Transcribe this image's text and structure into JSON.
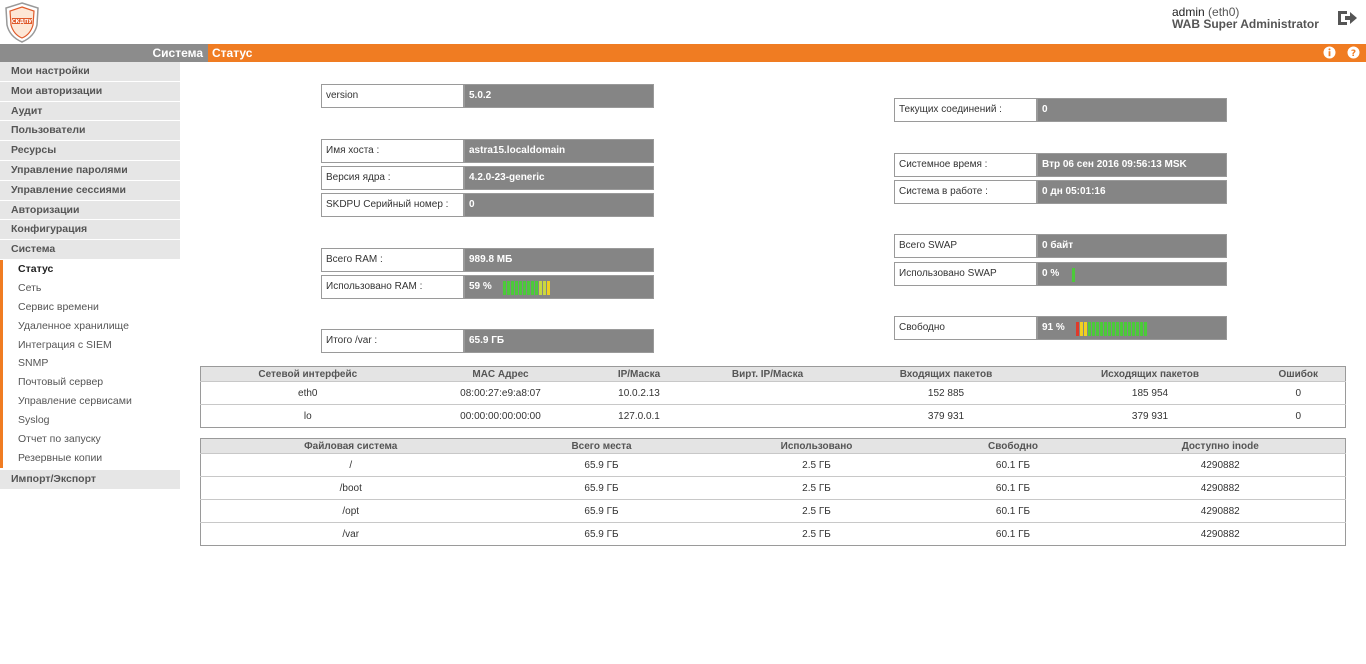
{
  "header": {
    "user": "admin",
    "interface": "(eth0)",
    "role": "WAB Super Administrator"
  },
  "bar": {
    "section": "Система",
    "page": "Статус"
  },
  "sidebar": {
    "top_items": [
      "Мои настройки",
      "Мои авторизации",
      "Аудит",
      "Пользователи",
      "Ресурсы",
      "Управление паролями",
      "Управление сессиями",
      "Авторизации",
      "Конфигурация",
      "Система"
    ],
    "sub_items": [
      "Статус",
      "Сеть",
      "Сервис времени",
      "Удаленное хранилище",
      "Интеграция с SIEM",
      "SNMP",
      "Почтовый сервер",
      "Управление сервисами",
      "Syslog",
      "Отчет по запуску",
      "Резервные копии"
    ],
    "bottom_item": "Импорт/Экспорт"
  },
  "left_info": {
    "version": {
      "label": "version",
      "value": "5.0.2"
    },
    "hostname": {
      "label": "Имя хоста :",
      "value": "astra15.localdomain"
    },
    "kernel": {
      "label": "Версия ядра :",
      "value": "4.2.0-23-generic"
    },
    "serial": {
      "label": "SKDPU Серийный номер :",
      "value": "0"
    },
    "ram_total": {
      "label": "Всего RAM :",
      "value": "989.8 МБ"
    },
    "ram_used": {
      "label": "Использовано RAM :",
      "value": "59 %",
      "fraction": 0.59
    },
    "var_total": {
      "label": "Итого /var :",
      "value": "65.9 ГБ"
    }
  },
  "right_info": {
    "connections": {
      "label": "Текущих соединений :",
      "value": "0"
    },
    "system_time": {
      "label": "Системное время :",
      "value": "Втр 06 сен 2016 09:56:13 MSK"
    },
    "uptime": {
      "label": "Система в работе :",
      "value": "0 дн 05:01:16"
    },
    "swap_total": {
      "label": "Всего SWAP",
      "value": "0 байт"
    },
    "swap_used": {
      "label": "Использовано SWAP",
      "value": "0 %",
      "fraction": 0.0
    },
    "free": {
      "label": "Свободно",
      "value": "91 %",
      "fraction": 0.91
    }
  },
  "net_table": {
    "headers": [
      "Сетевой интерфейс",
      "MAC Адрес",
      "IP/Маска",
      "Вирт. IP/Маска",
      "Входящих пакетов",
      "Исходящих пакетов",
      "Ошибок"
    ],
    "rows": [
      [
        "eth0",
        "08:00:27:e9:a8:07",
        "10.0.2.13",
        "",
        "152 885",
        "185 954",
        "0"
      ],
      [
        "lo",
        "00:00:00:00:00:00",
        "127.0.0.1",
        "",
        "379 931",
        "379 931",
        "0"
      ]
    ]
  },
  "fs_table": {
    "headers": [
      "Файловая система",
      "Всего места",
      "Использовано",
      "Свободно",
      "Доступно inode"
    ],
    "rows": [
      [
        "/",
        "65.9 ГБ",
        "2.5 ГБ",
        "60.1 ГБ",
        "4290882"
      ],
      [
        "/boot",
        "65.9 ГБ",
        "2.5 ГБ",
        "60.1 ГБ",
        "4290882"
      ],
      [
        "/opt",
        "65.9 ГБ",
        "2.5 ГБ",
        "60.1 ГБ",
        "4290882"
      ],
      [
        "/var",
        "65.9 ГБ",
        "2.5 ГБ",
        "60.1 ГБ",
        "4290882"
      ]
    ]
  },
  "colors": {
    "accent": "#f07c22",
    "value_bg": "#858585",
    "meter_green": "#4cc93a",
    "meter_yellow": "#f0d020",
    "meter_red": "#e03a2a"
  }
}
